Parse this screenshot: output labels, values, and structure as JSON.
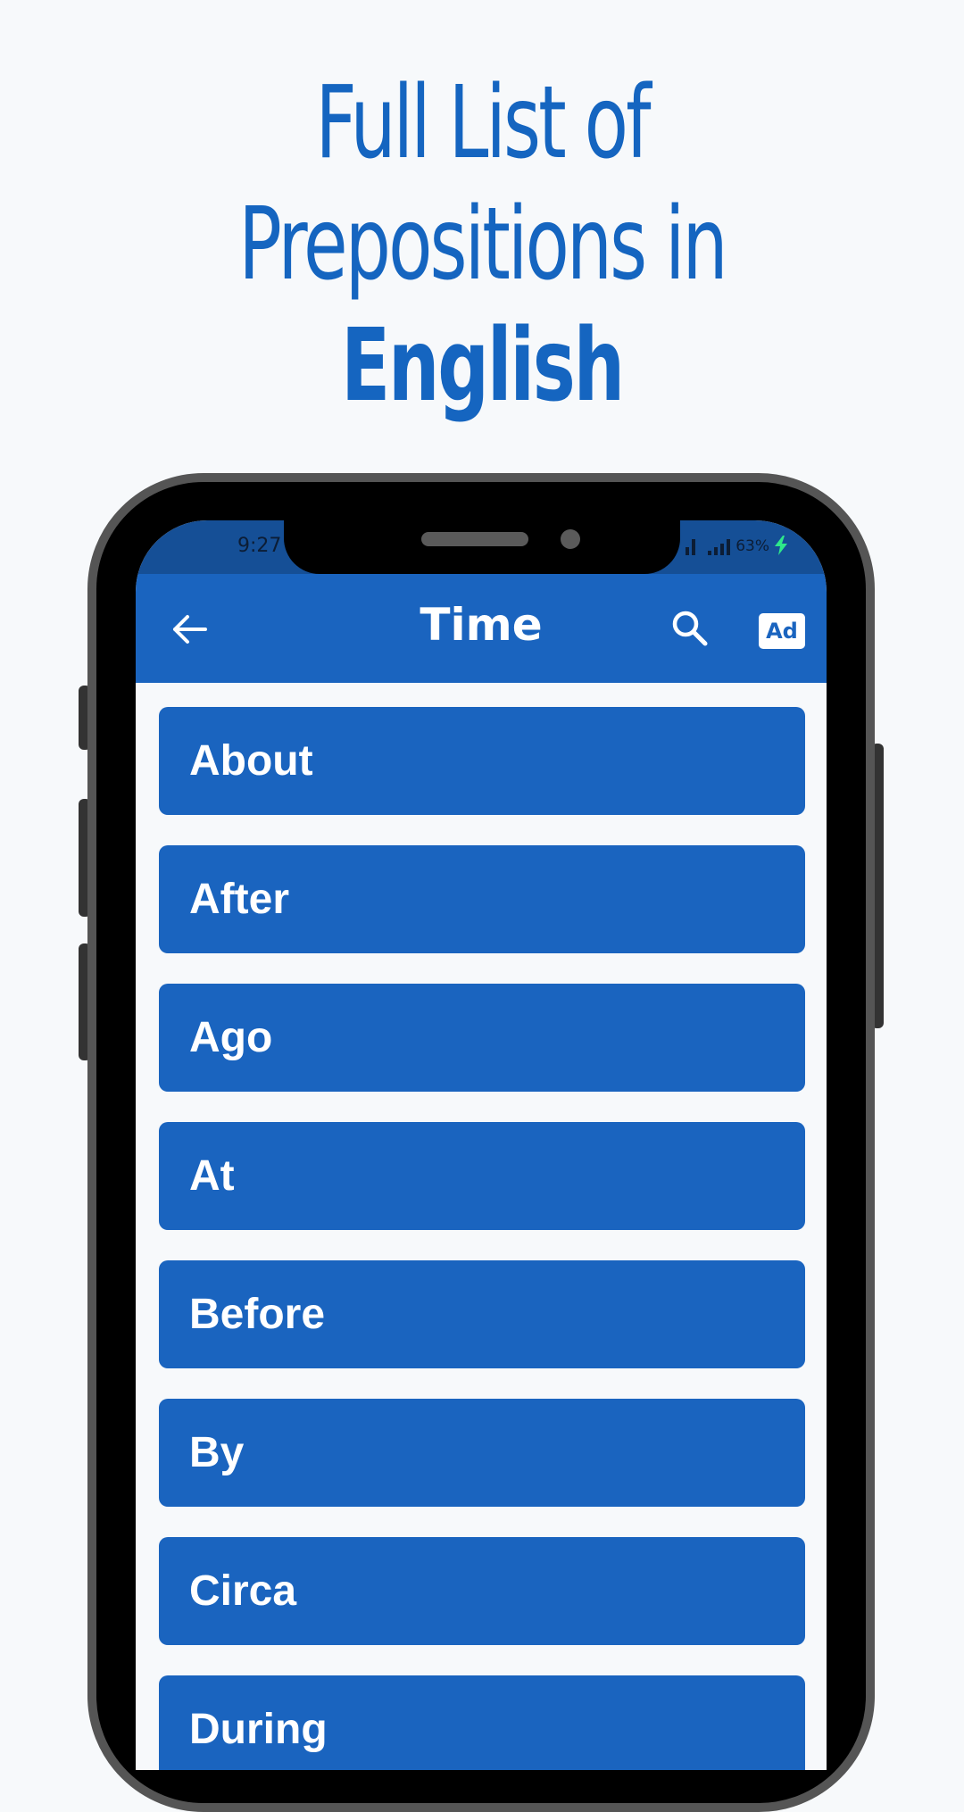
{
  "headline": {
    "line1": "Full List of",
    "line2": "Prepositions in",
    "line3": "English"
  },
  "status_bar": {
    "time": "9:27",
    "battery": "63%",
    "charging": true
  },
  "app_bar": {
    "title": "Time",
    "back_icon": "arrow-left-icon",
    "search_icon": "search-icon",
    "ad_label": "Ad"
  },
  "list": {
    "items": [
      {
        "label": "About"
      },
      {
        "label": "After"
      },
      {
        "label": "Ago"
      },
      {
        "label": "At"
      },
      {
        "label": "Before"
      },
      {
        "label": "By"
      },
      {
        "label": "Circa"
      },
      {
        "label": "During"
      }
    ]
  },
  "colors": {
    "brand_blue": "#1a64bf",
    "status_bar_blue": "#154f96",
    "headline_blue": "#1565c0",
    "charging_green": "#2ee88a",
    "background": "#f7f9fb"
  }
}
